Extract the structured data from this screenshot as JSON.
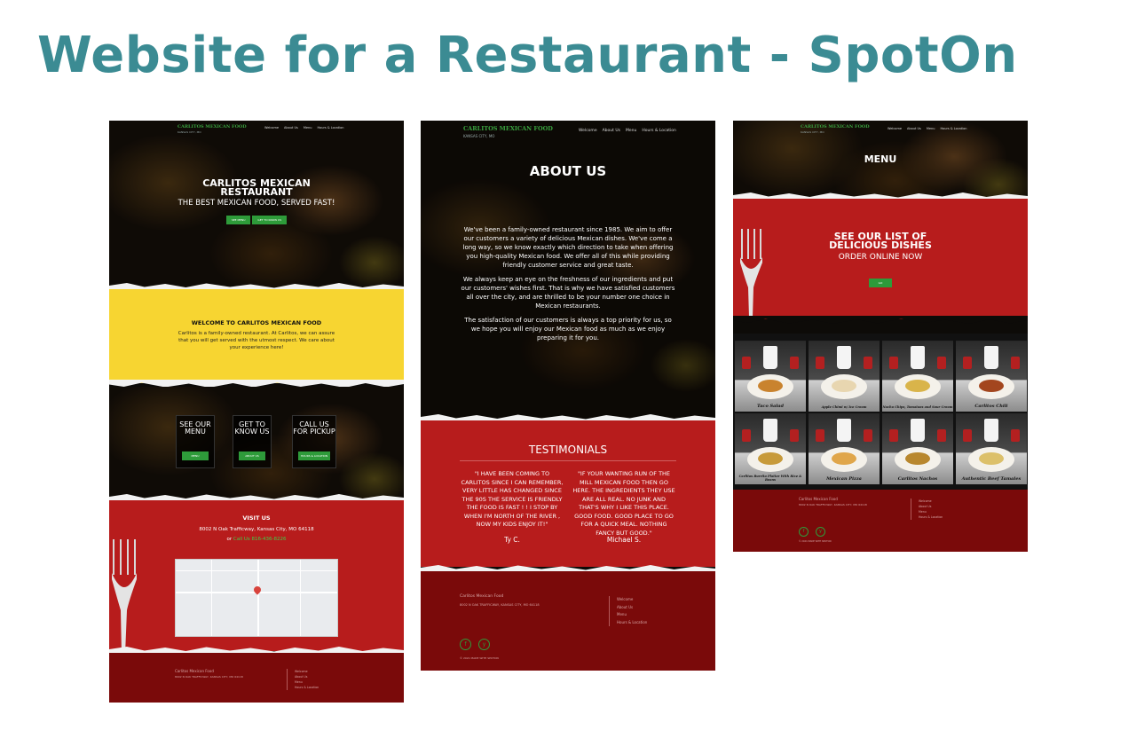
{
  "page_title": "Website for a  Restaurant - SpotOn",
  "site": {
    "brand": "CARLITOS MEXICAN FOOD",
    "brand_sub": "KANSAS CITY, MO",
    "nav": [
      "Welcome",
      "About Us",
      "Menu",
      "Hours & Location"
    ],
    "footer_name": "Carlitos Mexican Food",
    "footer_address": "8002 N OAK TRAFFICWAY, KANSAS CITY, MO 64118",
    "footer_links": [
      "Welcome",
      "About Us",
      "Menu",
      "Hours & Location"
    ],
    "footer_copy": "© 2021 MADE WITH SPOTON",
    "social_icons": [
      "facebook-icon",
      "yelp-icon"
    ]
  },
  "home": {
    "hero_title": "CARLITOS MEXICAN RESTAURANT",
    "hero_subtitle": "THE BEST MEXICAN FOOD, SERVED FAST!",
    "hero_buttons": [
      "SEE MENU",
      "GET TO KNOW US"
    ],
    "welcome_title": "WELCOME TO CARLITOS MEXICAN FOOD",
    "welcome_body": "Carlitos is a family-owned restaurant. At Carlitos, we can assure that you will get served with the utmost respect. We care about your experience here!",
    "tiles": [
      {
        "title": "SEE OUR MENU",
        "button": "MENU"
      },
      {
        "title": "GET TO KNOW US",
        "button": "ABOUT US"
      },
      {
        "title": "CALL US FOR PICKUP",
        "button": "HOURS & LOCATION"
      }
    ],
    "visit_title": "VISIT US",
    "visit_address": "8002 N Oak Trafficway, Kansas City, MO 64118",
    "visit_call_prefix": "or",
    "visit_call_link": "Call Us 816-436-8226"
  },
  "about": {
    "title": "ABOUT US",
    "paragraphs": [
      "We've been a family-owned restaurant since 1985. We aim to offer our customers a variety of delicious Mexican dishes. We've come a long way, so we know exactly which direction to take when offering you high-quality Mexican food. We offer all of this while providing friendly customer service and great taste.",
      "We always keep an eye on the freshness of our ingredients and put our customers' wishes first. That is why we have satisfied customers all over the city, and are thrilled to be your number one choice in Mexican restaurants.",
      "The satisfaction of our customers is always a top priority for us, so we hope you will enjoy our Mexican food as much as we enjoy preparing it for you."
    ],
    "testimonials_title": "TESTIMONIALS",
    "testimonials": [
      {
        "quote": "\"I have been coming to Carlitos since I can remember, very little has changed since the 90s the service is friendly the food is fast ! ! I stop by when I'm north of the river , now my kids enjoy it!\"",
        "name": "Ty C."
      },
      {
        "quote": "\"If your wanting run of the mill Mexican food then go here. The ingredients they use are all real. No junk and that's why I like this place. Good food. Good place to go for a quick meal. Nothing fancy but good.\"",
        "name": "Michael S."
      }
    ]
  },
  "menu": {
    "title": "MENU",
    "promo_title": "SEE OUR LIST OF DELICIOUS DISHES",
    "promo_subtitle": "ORDER ONLINE NOW",
    "promo_button": "GO",
    "dishes": [
      "Taco Salad",
      "Apple Chimi w/ Ice Cream",
      "Nacho Chips, Tomatoes and Sour Cream",
      "Carlitos Chili",
      "Carlitos Burrito Platter With Rice & Beans",
      "Mexican Pizza",
      "Carlitos Nachos",
      "Authentic Beef Tamales"
    ]
  },
  "colors": {
    "heading": "#3b8b93",
    "red": "#b71c1c",
    "footer": "#7a0a0a",
    "yellow": "#f7d531",
    "green": "#2e9b3a"
  }
}
